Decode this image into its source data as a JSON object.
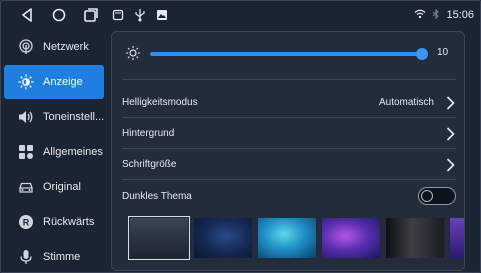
{
  "statusbar": {
    "nav": [
      "back-icon",
      "home-icon",
      "recents-icon"
    ],
    "notification_icons": [
      "screenshot-icon",
      "usb-icon",
      "image-icon"
    ],
    "time": "15:06"
  },
  "sidebar": {
    "items": [
      {
        "label": "Netzwerk",
        "icon": "network-icon"
      },
      {
        "label": "Anzeige",
        "icon": "display-icon",
        "active": true
      },
      {
        "label": "Toneinstell...",
        "icon": "speaker-icon"
      },
      {
        "label": "Allgemeines",
        "icon": "general-icon"
      },
      {
        "label": "Original",
        "icon": "car-icon"
      },
      {
        "label": "Rückwärts",
        "icon": "reverse-icon"
      },
      {
        "label": "Stimme",
        "icon": "microphone-icon"
      }
    ]
  },
  "brightness": {
    "value": "10",
    "level_fraction": 1.0
  },
  "rows": {
    "mode_label": "Helligkeitsmodus",
    "mode_value": "Automatisch",
    "background_label": "Hintergrund",
    "font_size_label": "Schriftgröße",
    "dark_theme_label": "Dunkles Thema",
    "dark_theme_on": false
  },
  "wallpapers": [
    "wallpaper-gray",
    "wallpaper-dark-blue",
    "wallpaper-cyan",
    "wallpaper-purple",
    "wallpaper-black",
    "wallpaper-violet"
  ],
  "colors": {
    "accent": "#1f7fe0",
    "background": "#1b2433",
    "panel": "#222c3b"
  }
}
